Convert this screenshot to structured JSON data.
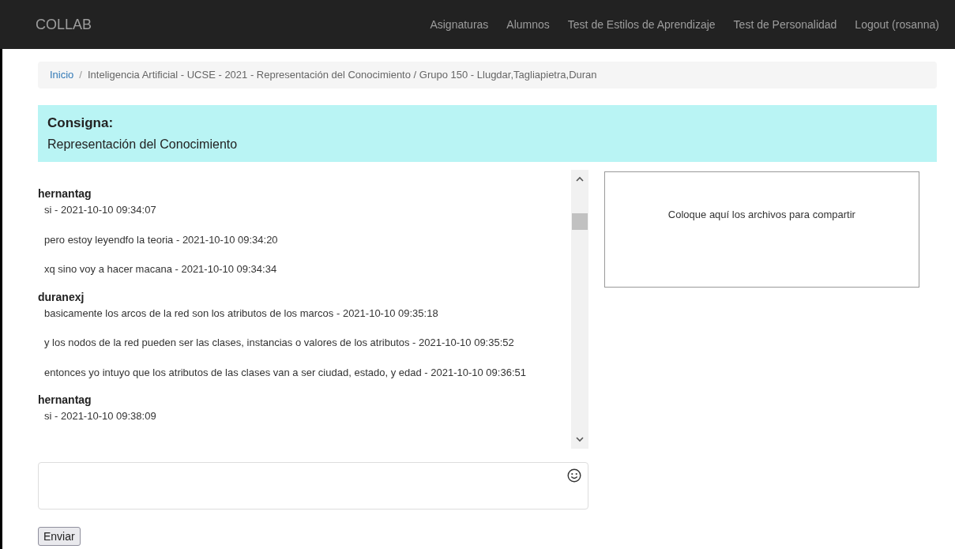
{
  "navbar": {
    "brand": "COLLAB",
    "links": [
      "Asignaturas",
      "Alumnos",
      "Test de Estilos de Aprendizaje",
      "Test de Personalidad",
      "Logout (rosanna)"
    ]
  },
  "breadcrumb_separator": "/",
  "breadcrumb": [
    {
      "label": "Inicio",
      "kind": "link"
    },
    {
      "label": "Inteligencia Artificial - UCSE - 2021 - Representación del Conocimiento / Grupo 150 - Llugdar,Tagliapietra,Duran",
      "kind": "current"
    }
  ],
  "assignment": {
    "heading": "Consigna:",
    "text": "Representación del Conocimiento"
  },
  "chat": [
    {
      "author": "hernantag",
      "messages": [
        "si - 2021-10-10 09:34:07",
        "pero estoy leyendfo la teoria - 2021-10-10 09:34:20",
        "xq sino voy a hacer macana - 2021-10-10 09:34:34"
      ]
    },
    {
      "author": "duranexj",
      "messages": [
        "basicamente los arcos de la red son los atributos de los marcos - 2021-10-10 09:35:18",
        "y los nodos de la red pueden ser las clases, instancias o valores de los atributos - 2021-10-10 09:35:52",
        "entonces yo intuyo que los atributos de las clases van a ser ciudad, estado, y edad - 2021-10-10 09:36:51"
      ]
    },
    {
      "author": "hernantag",
      "messages": [
        "si - 2021-10-10 09:38:09"
      ]
    }
  ],
  "dropzone": {
    "text": "Coloque aquí los archivos para compartir"
  },
  "send_button": "Enviar"
}
